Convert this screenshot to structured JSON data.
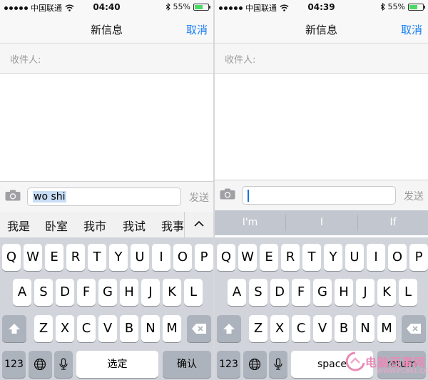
{
  "screens": [
    {
      "status": {
        "carrier": "中国联通",
        "time": "04:40",
        "battery": "55%"
      },
      "nav": {
        "title": "新信息",
        "cancel": "取消"
      },
      "recipient_label": "收件人:",
      "input": {
        "text": "wo shi"
      },
      "send_label": "发送",
      "candidates": [
        "我是",
        "卧室",
        "我市",
        "我试",
        "我事"
      ],
      "keyboard": {
        "num_key": "123",
        "mid_key": "选定",
        "return_key": "确认"
      }
    },
    {
      "status": {
        "carrier": "中国联通",
        "time": "04:39",
        "battery": "55%"
      },
      "nav": {
        "title": "新信息",
        "cancel": "取消"
      },
      "recipient_label": "收件人:",
      "input": {
        "text": ""
      },
      "send_label": "发送",
      "predictions": [
        "I'm",
        "I",
        "If"
      ],
      "keyboard": {
        "num_key": "123",
        "mid_key": "space",
        "return_key": "return"
      }
    }
  ],
  "keyboard_rows": {
    "row1": [
      "Q",
      "W",
      "E",
      "R",
      "T",
      "Y",
      "U",
      "I",
      "O",
      "P"
    ],
    "row2": [
      "A",
      "S",
      "D",
      "F",
      "G",
      "H",
      "J",
      "K",
      "L"
    ],
    "row3": [
      "Z",
      "X",
      "C",
      "V",
      "B",
      "N",
      "M"
    ]
  },
  "watermark": {
    "brand": "电脑百事网",
    "url": "WWW.PC841.COM"
  },
  "colors": {
    "accent": "#1a7ef4",
    "battery": "#4cd964",
    "keyboard_bg": "#d1d5db",
    "predictive_bg": "#c2c7cf"
  }
}
